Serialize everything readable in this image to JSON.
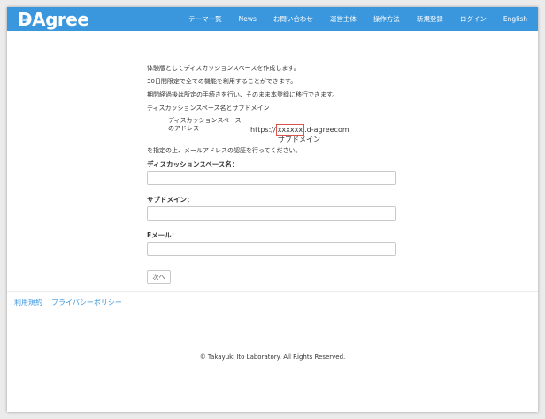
{
  "brand": {
    "logo_text": "Agree",
    "logo_initial": "D"
  },
  "nav": {
    "items": [
      "テーマ一覧",
      "News",
      "お問い合わせ",
      "運営主体",
      "操作方法",
      "新規登録",
      "ログイン",
      "English"
    ]
  },
  "intro": {
    "line1": "体験版としてディスカッションスペースを作成します。",
    "line2": "30日間限定で全ての機能を利用することができます。",
    "line3": "期間経過後は所定の手続きを行い、そのまま本登録に移行できます。",
    "line4": "ディスカッションスペース名とサブドメイン"
  },
  "address": {
    "label_line1": "ディスカッションスペース",
    "label_line2": "のアドレス",
    "url_prefix": "https://",
    "url_placeholder": "xxxxxx",
    "url_suffix": ".d-agreecom",
    "sub_label": "サブドメイン"
  },
  "instruction": "を指定の上、メールアドレスの認証を行ってください。",
  "form": {
    "space_name_label": "ディスカッションスペース名：",
    "space_name_value": "",
    "subdomain_label": "サブドメイン：",
    "subdomain_value": "",
    "email_label": "Eメール：",
    "email_value": "",
    "next_button": "次へ"
  },
  "footer": {
    "terms": "利用規約",
    "privacy": "プライバシーポリシー",
    "copyright": "© Takayuki Ito Laboratory. All Rights Reserved."
  },
  "colors": {
    "nav_bg": "#3a97dd",
    "link": "#3a97dd",
    "highlight_box": "#d9534f"
  }
}
